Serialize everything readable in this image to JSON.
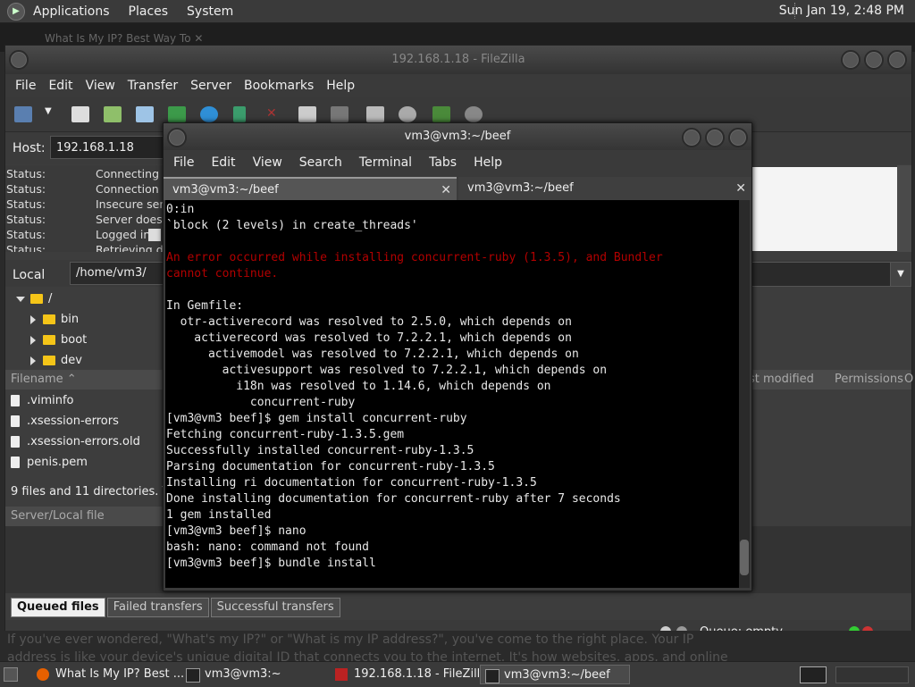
{
  "top_panel": {
    "menus": [
      "Applications",
      "Places",
      "System"
    ],
    "clock": "Sun Jan 19,  2:48 PM"
  },
  "browser": {
    "tab_title": "What Is My IP? Best Way To",
    "bg_text_line1": "If you've ever wondered, \"What's my IP?\" or \"What is my IP address?\", you've come to the right place. Your IP",
    "bg_text_line2": "address is like your device's unique digital ID that connects you to the internet. It's how websites, apps, and online"
  },
  "filezilla": {
    "title": "192.168.1.18 - FileZilla",
    "menu": [
      "File",
      "Edit",
      "View",
      "Transfer",
      "Server",
      "Bookmarks",
      "Help"
    ],
    "host_label": "Host:",
    "host_value": "192.168.1.18",
    "log": [
      {
        "k": "Status:",
        "v": "Connecting t"
      },
      {
        "k": "Status:",
        "v": "Connection e"
      },
      {
        "k": "Status:",
        "v": "Insecure serv"
      },
      {
        "k": "Status:",
        "v": "Server does n"
      },
      {
        "k": "Status:",
        "v": "Logged in"
      },
      {
        "k": "Status:",
        "v": "Retrieving di"
      }
    ],
    "local_label": "Local",
    "local_path": "/home/vm3/",
    "tree": [
      "/",
      "bin",
      "boot",
      "dev"
    ],
    "files_header": "Filename",
    "remote_headers": [
      "st modified",
      "Permissions",
      "O"
    ],
    "files": [
      ".viminfo",
      ".xsession-errors",
      ".xsession-errors.old",
      "penis.pem"
    ],
    "files_status": "9 files and 11 directories. Tot",
    "queue_header": "Server/Local file",
    "queue_tabs": [
      "Queued files",
      "Failed transfers",
      "Successful transfers"
    ],
    "queue_status": "Queue: empty"
  },
  "terminal": {
    "title": "vm3@vm3:~/beef",
    "menu": [
      "File",
      "Edit",
      "View",
      "Search",
      "Terminal",
      "Tabs",
      "Help"
    ],
    "tabs": [
      "vm3@vm3:~/beef",
      "vm3@vm3:~/beef"
    ],
    "close_glyph": "✕",
    "lines": [
      {
        "t": "0:in",
        "err": false
      },
      {
        "t": "`block (2 levels) in create_threads'",
        "err": false
      },
      {
        "t": "",
        "err": false
      },
      {
        "t": "An error occurred while installing concurrent-ruby (1.3.5), and Bundler",
        "err": true
      },
      {
        "t": "cannot continue.",
        "err": true
      },
      {
        "t": "",
        "err": false
      },
      {
        "t": "In Gemfile:",
        "err": false
      },
      {
        "t": "  otr-activerecord was resolved to 2.5.0, which depends on",
        "err": false
      },
      {
        "t": "    activerecord was resolved to 7.2.2.1, which depends on",
        "err": false
      },
      {
        "t": "      activemodel was resolved to 7.2.2.1, which depends on",
        "err": false
      },
      {
        "t": "        activesupport was resolved to 7.2.2.1, which depends on",
        "err": false
      },
      {
        "t": "          i18n was resolved to 1.14.6, which depends on",
        "err": false
      },
      {
        "t": "            concurrent-ruby",
        "err": false
      },
      {
        "t": "[vm3@vm3 beef]$ gem install concurrent-ruby",
        "err": false
      },
      {
        "t": "Fetching concurrent-ruby-1.3.5.gem",
        "err": false
      },
      {
        "t": "Successfully installed concurrent-ruby-1.3.5",
        "err": false
      },
      {
        "t": "Parsing documentation for concurrent-ruby-1.3.5",
        "err": false
      },
      {
        "t": "Installing ri documentation for concurrent-ruby-1.3.5",
        "err": false
      },
      {
        "t": "Done installing documentation for concurrent-ruby after 7 seconds",
        "err": false
      },
      {
        "t": "1 gem installed",
        "err": false
      },
      {
        "t": "[vm3@vm3 beef]$ nano",
        "err": false
      },
      {
        "t": "bash: nano: command not found",
        "err": false
      },
      {
        "t": "[vm3@vm3 beef]$ bundle install",
        "err": false
      }
    ]
  },
  "taskbar": {
    "items": [
      "What Is My IP? Best ...",
      "vm3@vm3:~",
      "192.168.1.18 - FileZilla",
      "vm3@vm3:~/beef"
    ]
  },
  "colors": {
    "error_red": "#b20000",
    "folder_yellow": "#f5c518",
    "terminal_bg": "#000000"
  }
}
